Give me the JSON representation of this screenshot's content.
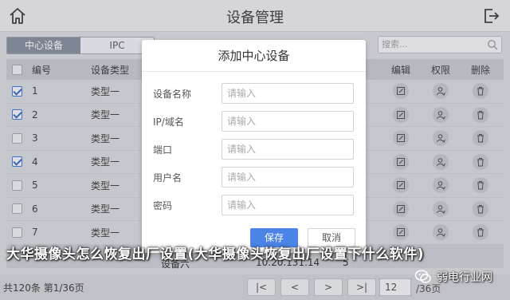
{
  "header": {
    "title": "设备管理",
    "home_icon": "home-icon",
    "exit_icon": "exit-icon"
  },
  "tabs": [
    {
      "label": "中心设备",
      "active": true
    },
    {
      "label": "IPC",
      "active": false
    }
  ],
  "search": {
    "placeholder": "搜索..."
  },
  "table": {
    "headers": {
      "no": "编号",
      "type": "设备类型",
      "edit": "编辑",
      "perm": "权限",
      "del": "删除"
    },
    "rows": [
      {
        "no": "1",
        "type": "类型一",
        "checked": true
      },
      {
        "no": "2",
        "type": "类型一",
        "checked": true
      },
      {
        "no": "3",
        "type": "类型一",
        "checked": false
      },
      {
        "no": "4",
        "type": "类型一",
        "checked": true
      },
      {
        "no": "5",
        "type": "类型一",
        "checked": false
      },
      {
        "no": "6",
        "type": "类型一",
        "checked": false
      },
      {
        "no": "7",
        "type": "类型一",
        "checked": false
      },
      {
        "no": "8",
        "type": "设备六",
        "checked": false
      }
    ],
    "row8_ip": "10.20.131.14",
    "row8_port": "5"
  },
  "pagination": {
    "info": "共120条  第1/36页",
    "first": "|<",
    "prev": "<",
    "next": ">",
    "last": ">|",
    "page_input": "12",
    "total": "/36页"
  },
  "modal": {
    "title": "添加中心设备",
    "fields": [
      {
        "label": "设备名称",
        "placeholder": "请输入"
      },
      {
        "label": "IP/域名",
        "placeholder": "请输入"
      },
      {
        "label": "端口",
        "placeholder": "请输入"
      },
      {
        "label": "用户名",
        "placeholder": "请输入"
      },
      {
        "label": "密码",
        "placeholder": "请输入"
      }
    ],
    "save": "保存",
    "cancel": "取消"
  },
  "caption": "大华摄像头怎么恢复出厂设置(大华摄像头恢复出厂设置下什么软件)",
  "watermark": "弱电行业网",
  "colors": {
    "accent": "#4a84e6",
    "tab_active": "#7f8896",
    "check": "#2f64c8"
  }
}
